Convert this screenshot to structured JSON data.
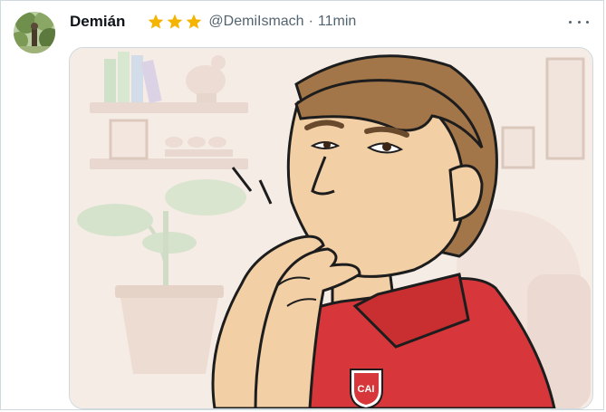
{
  "tweet": {
    "author_name": "Demián",
    "handle": "@DemiIsmach",
    "separator": "·",
    "timestamp": "11min",
    "rating_stars": 3,
    "icons": {
      "avatar": "avatar-icon",
      "star": "star-icon",
      "more": "more-horizontal-icon"
    },
    "image": {
      "badge_text": "CAI"
    }
  },
  "colors": {
    "star": "#f4b400",
    "secondary_text": "#536471",
    "border": "#cfd9de",
    "shirt": "#d7373a"
  }
}
